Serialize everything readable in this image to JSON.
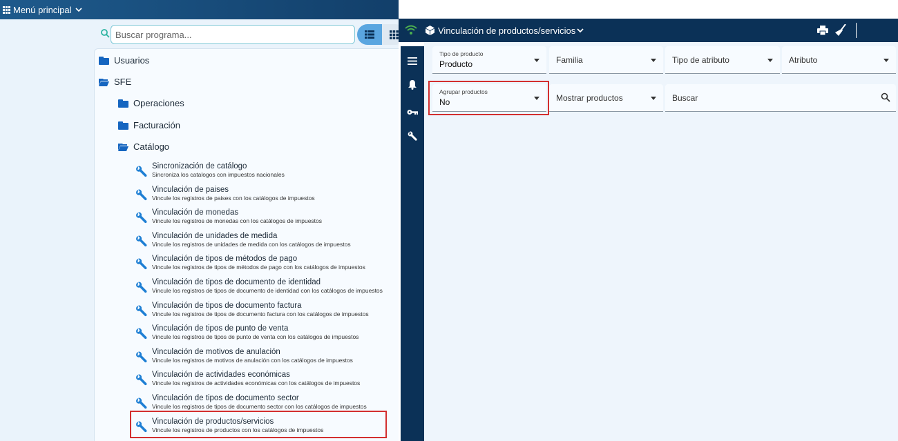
{
  "left_menu": {
    "title": "Menú principal",
    "search_placeholder": "Buscar programa...",
    "tree": {
      "users": "Usuarios",
      "sfe": "SFE",
      "operaciones": "Operaciones",
      "facturacion": "Facturación",
      "catalogo": "Catálogo",
      "programs": [
        {
          "title": "Sincronización de catálogo",
          "subtitle": "Sincroniza los catalogos con impuestos nacionales"
        },
        {
          "title": "Vinculación de paises",
          "subtitle": "Vincule los registros de paises con los catálogos de impuestos"
        },
        {
          "title": "Vinculación de monedas",
          "subtitle": "Vincule los registros de monedas con los catálogos de impuestos"
        },
        {
          "title": "Vinculación de unidades de medida",
          "subtitle": "Vincule los registros de unidades de medida con los catálogos de impuestos"
        },
        {
          "title": "Vinculación de tipos de métodos de pago",
          "subtitle": "Vincule los registros de tipos de métodos de pago con los catálogos de impuestos"
        },
        {
          "title": "Vinculación de tipos de documento de identidad",
          "subtitle": "Vincule los registros de tipos de documento de identidad con los catálogos de impuestos"
        },
        {
          "title": "Vinculación de tipos de documento factura",
          "subtitle": "Vincule los registros de tipos de documento factura con los catálogos de impuestos"
        },
        {
          "title": "Vinculación de tipos de punto de venta",
          "subtitle": "Vincule los registros de tipos de punto de venta con los catálogos de impuestos"
        },
        {
          "title": "Vinculación de motivos de anulación",
          "subtitle": "Vincule los registros de motivos de anulación con los catálogos de impuestos"
        },
        {
          "title": "Vinculación de actividades económicas",
          "subtitle": "Vincule los registros de actividades económicas con los catálogos de impuestos"
        },
        {
          "title": "Vinculación de tipos de documento sector",
          "subtitle": "Vincule los registros de tipos de documento sector con los catálogos de impuestos"
        },
        {
          "title": "Vinculación de productos/servicios",
          "subtitle": "Vincule los registros de productos con los catálogos de impuestos"
        }
      ]
    }
  },
  "app": {
    "title": "Vinculación de productos/servicios",
    "filters": {
      "tipo_producto_label": "Tipo de producto",
      "tipo_producto_value": "Producto",
      "familia": "Familia",
      "tipo_atributo": "Tipo de atributo",
      "atributo": "Atributo",
      "agrupar_label": "Agrupar productos",
      "agrupar_value": "No",
      "mostrar": "Mostrar productos",
      "buscar_placeholder": "Buscar"
    }
  },
  "colors": {
    "highlight": "#d32f2f",
    "appbar": "#0b3157",
    "folder": "#1565c0",
    "accent": "#5aa6e0"
  }
}
